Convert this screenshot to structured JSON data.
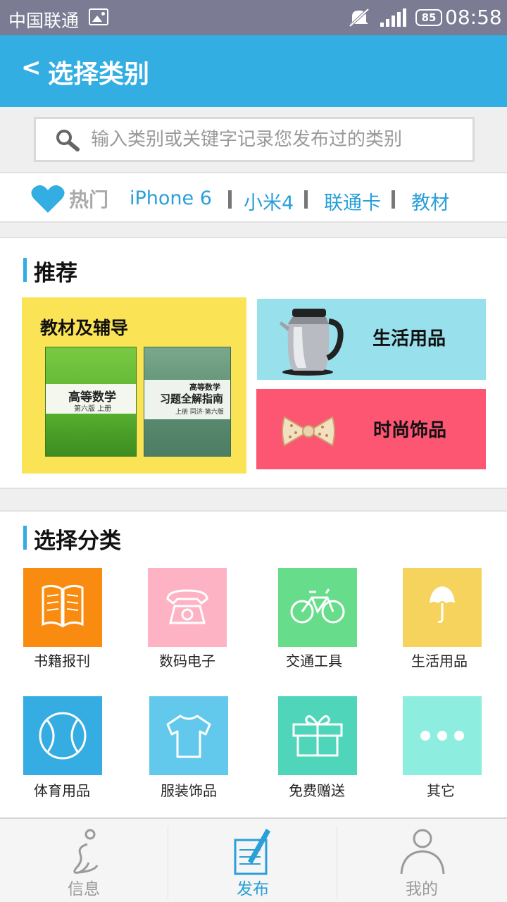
{
  "status_bar": {
    "carrier": "中国联通",
    "battery": "85",
    "time": "08:58"
  },
  "header": {
    "back_glyph": "<",
    "title": "选择类别"
  },
  "search": {
    "placeholder": "输入类别或关键字记录您发布过的类别",
    "value": ""
  },
  "hot": {
    "label": "热门",
    "items": [
      "iPhone 6",
      "小米4",
      "联通卡",
      "教材"
    ]
  },
  "recommend": {
    "title": "推荐",
    "tiles": [
      {
        "label": "教材及辅导",
        "color": "#fbe356"
      },
      {
        "label": "生活用品",
        "color": "#98e0ec"
      },
      {
        "label": "时尚饰品",
        "color": "#fd5673"
      }
    ],
    "books": [
      {
        "title": "高等数学",
        "subtitle": "第六版 上册"
      },
      {
        "title_top": "高等数学",
        "title": "习题全解指南",
        "subtitle": "上册 同济·第六版"
      }
    ]
  },
  "categories": {
    "title": "选择分类",
    "items": [
      {
        "label": "书籍报刊",
        "icon": "book-icon",
        "color": "#f98c10"
      },
      {
        "label": "数码电子",
        "icon": "telephone-icon",
        "color": "#fdb3c4"
      },
      {
        "label": "交通工具",
        "icon": "bicycle-icon",
        "color": "#67dd8b"
      },
      {
        "label": "生活用品",
        "icon": "umbrella-icon",
        "color": "#f6d35d"
      },
      {
        "label": "体育用品",
        "icon": "baseball-icon",
        "color": "#35ade2"
      },
      {
        "label": "服装饰品",
        "icon": "tshirt-icon",
        "color": "#62c9ec"
      },
      {
        "label": "免费赠送",
        "icon": "gift-icon",
        "color": "#4fd5b9"
      },
      {
        "label": "其它",
        "icon": "more-icon",
        "color": "#8deedf"
      }
    ]
  },
  "bottom_nav": {
    "items": [
      {
        "label": "信息",
        "icon": "info-icon",
        "active": false
      },
      {
        "label": "发布",
        "icon": "publish-icon",
        "active": true
      },
      {
        "label": "我的",
        "icon": "profile-icon",
        "active": false
      }
    ],
    "active_color": "#2a9fd8",
    "inactive_color": "#9a9a9a"
  }
}
